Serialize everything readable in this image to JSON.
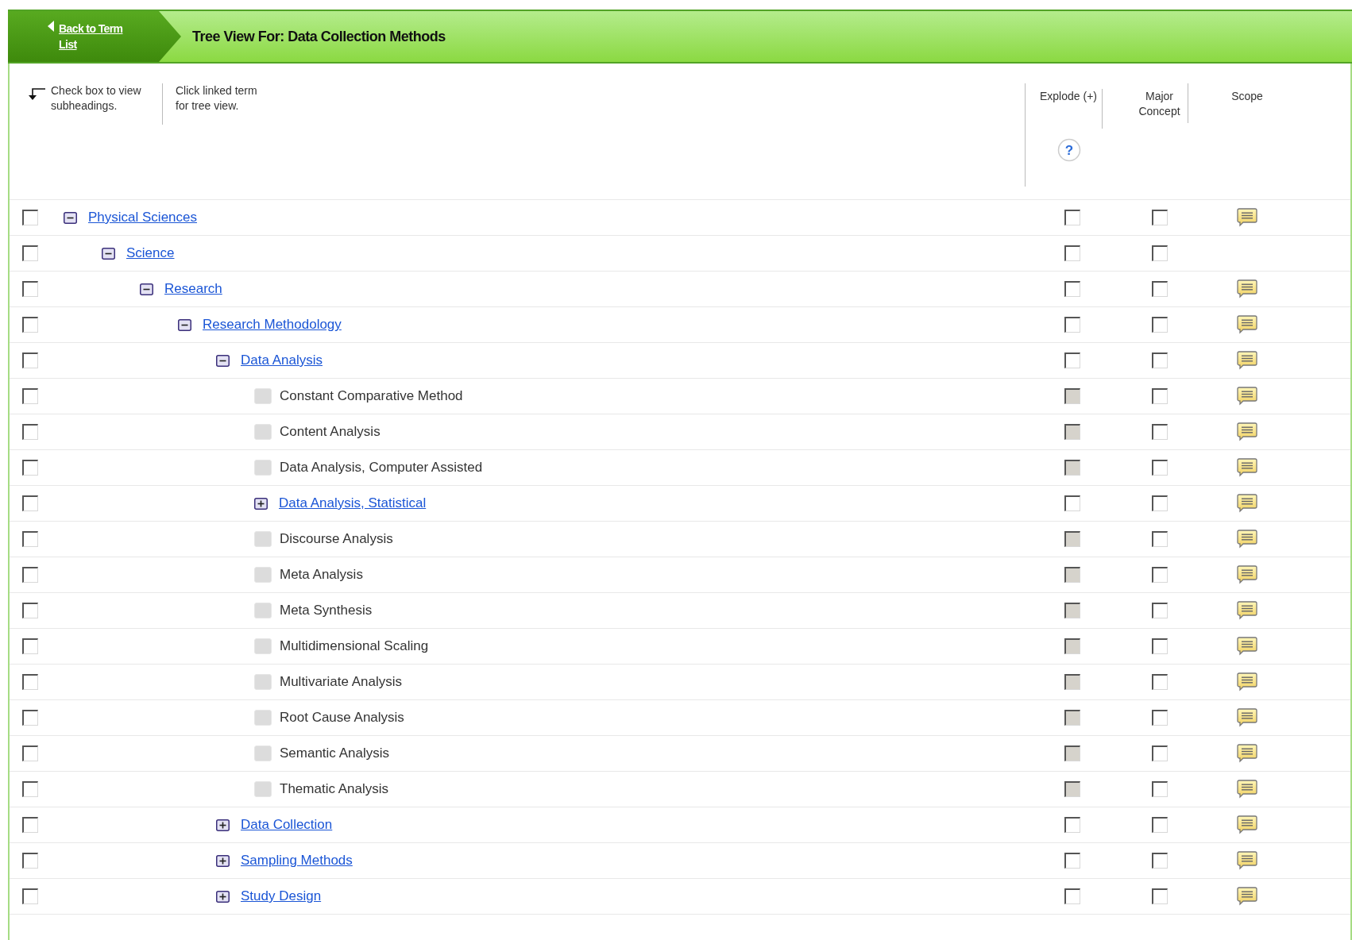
{
  "header": {
    "back_link": "Back to Term List",
    "title": "Tree View For: Data Collection Methods"
  },
  "hints": [
    "Check box to view subheadings.",
    "Click linked term for tree view."
  ],
  "columns": {
    "explode": "Explode (+)",
    "help": "?",
    "major": "Major Concept",
    "scope": "Scope"
  },
  "tree": [
    {
      "term": "Physical Sciences",
      "kind": "branch",
      "expanded": true,
      "checked": false,
      "explode_checked": false,
      "explode_disabled": false,
      "major_checked": false,
      "scope": true,
      "children": [
        {
          "term": "Science",
          "kind": "branch",
          "expanded": true,
          "checked": false,
          "explode_checked": false,
          "explode_disabled": false,
          "major_checked": false,
          "scope": false,
          "children": [
            {
              "term": "Research",
              "kind": "branch",
              "expanded": true,
              "checked": false,
              "explode_checked": false,
              "explode_disabled": false,
              "major_checked": false,
              "scope": true,
              "children": [
                {
                  "term": "Research Methodology",
                  "kind": "branch",
                  "expanded": true,
                  "checked": false,
                  "explode_checked": false,
                  "explode_disabled": false,
                  "major_checked": false,
                  "scope": true,
                  "children": [
                    {
                      "term": "Data Analysis",
                      "kind": "branch",
                      "expanded": true,
                      "checked": false,
                      "explode_checked": false,
                      "explode_disabled": false,
                      "major_checked": false,
                      "scope": true,
                      "children": [
                        {
                          "term": "Constant Comparative Method",
                          "kind": "leaf",
                          "checked": false,
                          "explode_checked": false,
                          "explode_disabled": true,
                          "major_checked": false,
                          "scope": true
                        },
                        {
                          "term": "Content Analysis",
                          "kind": "leaf",
                          "checked": false,
                          "explode_checked": false,
                          "explode_disabled": true,
                          "major_checked": false,
                          "scope": true
                        },
                        {
                          "term": "Data Analysis, Computer Assisted",
                          "kind": "leaf",
                          "checked": false,
                          "explode_checked": false,
                          "explode_disabled": true,
                          "major_checked": false,
                          "scope": true
                        },
                        {
                          "term": "Data Analysis, Statistical",
                          "kind": "branch",
                          "expanded": false,
                          "checked": false,
                          "explode_checked": false,
                          "explode_disabled": false,
                          "major_checked": false,
                          "scope": true
                        },
                        {
                          "term": "Discourse Analysis",
                          "kind": "leaf",
                          "checked": false,
                          "explode_checked": false,
                          "explode_disabled": true,
                          "major_checked": false,
                          "scope": true
                        },
                        {
                          "term": "Meta Analysis",
                          "kind": "leaf",
                          "checked": false,
                          "explode_checked": false,
                          "explode_disabled": true,
                          "major_checked": false,
                          "scope": true
                        },
                        {
                          "term": "Meta Synthesis",
                          "kind": "leaf",
                          "checked": false,
                          "explode_checked": false,
                          "explode_disabled": true,
                          "major_checked": false,
                          "scope": true
                        },
                        {
                          "term": "Multidimensional Scaling",
                          "kind": "leaf",
                          "checked": false,
                          "explode_checked": false,
                          "explode_disabled": true,
                          "major_checked": false,
                          "scope": true
                        },
                        {
                          "term": "Multivariate Analysis",
                          "kind": "leaf",
                          "checked": false,
                          "explode_checked": false,
                          "explode_disabled": true,
                          "major_checked": false,
                          "scope": true
                        },
                        {
                          "term": "Root Cause Analysis",
                          "kind": "leaf",
                          "checked": false,
                          "explode_checked": false,
                          "explode_disabled": true,
                          "major_checked": false,
                          "scope": true
                        },
                        {
                          "term": "Semantic Analysis",
                          "kind": "leaf",
                          "checked": false,
                          "explode_checked": false,
                          "explode_disabled": true,
                          "major_checked": false,
                          "scope": true
                        },
                        {
                          "term": "Thematic Analysis",
                          "kind": "leaf",
                          "checked": false,
                          "explode_checked": false,
                          "explode_disabled": true,
                          "major_checked": false,
                          "scope": true
                        }
                      ]
                    },
                    {
                      "term": "Data Collection",
                      "kind": "branch",
                      "expanded": false,
                      "checked": false,
                      "explode_checked": false,
                      "explode_disabled": false,
                      "major_checked": false,
                      "scope": true
                    },
                    {
                      "term": "Sampling Methods",
                      "kind": "branch",
                      "expanded": false,
                      "checked": false,
                      "explode_checked": false,
                      "explode_disabled": false,
                      "major_checked": false,
                      "scope": true
                    },
                    {
                      "term": "Study Design",
                      "kind": "branch",
                      "expanded": false,
                      "checked": false,
                      "explode_checked": false,
                      "explode_disabled": false,
                      "major_checked": false,
                      "scope": true
                    }
                  ]
                }
              ]
            }
          ]
        }
      ]
    }
  ]
}
